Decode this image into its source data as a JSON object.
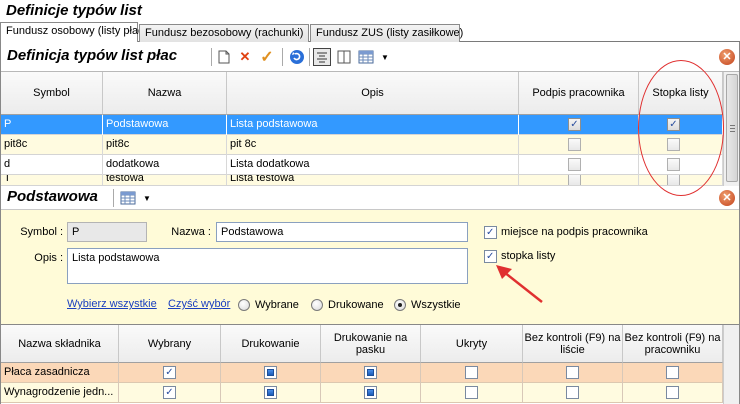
{
  "window_title": "Definicje typów list",
  "tabs": [
    {
      "label": "Fundusz osobowy (listy płac)",
      "active": true
    },
    {
      "label": "Fundusz bezosobowy (rachunki)",
      "active": false
    },
    {
      "label": "Fundusz ZUS (listy zasiłkowe)",
      "active": false
    }
  ],
  "list_panel": {
    "title": "Definicja typów list płac",
    "toolbar": [
      "new-document-icon",
      "delete-icon",
      "confirm-icon",
      "refresh-icon",
      "filter-icon",
      "columns-icon",
      "grid-options-icon"
    ],
    "columns": [
      "Symbol",
      "Nazwa",
      "Opis",
      "Podpis pracownika",
      "Stopka listy"
    ],
    "rows": [
      {
        "symbol": "P",
        "nazwa": "Podstawowa",
        "opis": "Lista podstawowa",
        "podpis": true,
        "stopka": true
      },
      {
        "symbol": "pit8c",
        "nazwa": "pit8c",
        "opis": "pit 8c",
        "podpis": false,
        "stopka": false
      },
      {
        "symbol": "d",
        "nazwa": "dodatkowa",
        "opis": "Lista dodatkowa",
        "podpis": false,
        "stopka": false
      },
      {
        "symbol": "T",
        "nazwa": "testowa",
        "opis": "Lista testowa",
        "podpis": false,
        "stopka": false
      }
    ]
  },
  "detail_panel": {
    "title": "Podstawowa",
    "symbol_label": "Symbol :",
    "symbol_value": "P",
    "nazwa_label": "Nazwa :",
    "nazwa_value": "Podstawowa",
    "opis_label": "Opis :",
    "opis_value": "Lista podstawowa",
    "chk_podpis_label": "miejsce na podpis pracownika",
    "chk_stopka_label": "stopka listy",
    "link_select_all": "Wybierz wszystkie",
    "link_clear": "Czyść wybór",
    "radio_wybrane": "Wybrane",
    "radio_drukowane": "Drukowane",
    "radio_wszystkie": "Wszystkie"
  },
  "components_grid": {
    "columns": [
      "Nazwa składnika",
      "Wybrany",
      "Drukowanie",
      "Drukowanie na pasku",
      "Ukryty",
      "Bez kontroli (F9) na liście",
      "Bez kontroli (F9) na pracowniku"
    ],
    "rows": [
      {
        "name": "Płaca zasadnicza",
        "wybrany": true,
        "drukowanie": true,
        "pasek": true,
        "ukryty": false,
        "f9_lista": false,
        "f9_prac": false
      },
      {
        "name": "Wynagrodzenie jedn...",
        "wybrany": true,
        "drukowanie": true,
        "pasek": true,
        "ukryty": false,
        "f9_lista": false,
        "f9_prac": false
      }
    ]
  },
  "colors": {
    "selection": "#3399ff",
    "row_yellow": "#fffbe0",
    "detail_bg": "#fffbd8",
    "row_peach": "#fbd8b8",
    "annotation": "#e03030"
  }
}
